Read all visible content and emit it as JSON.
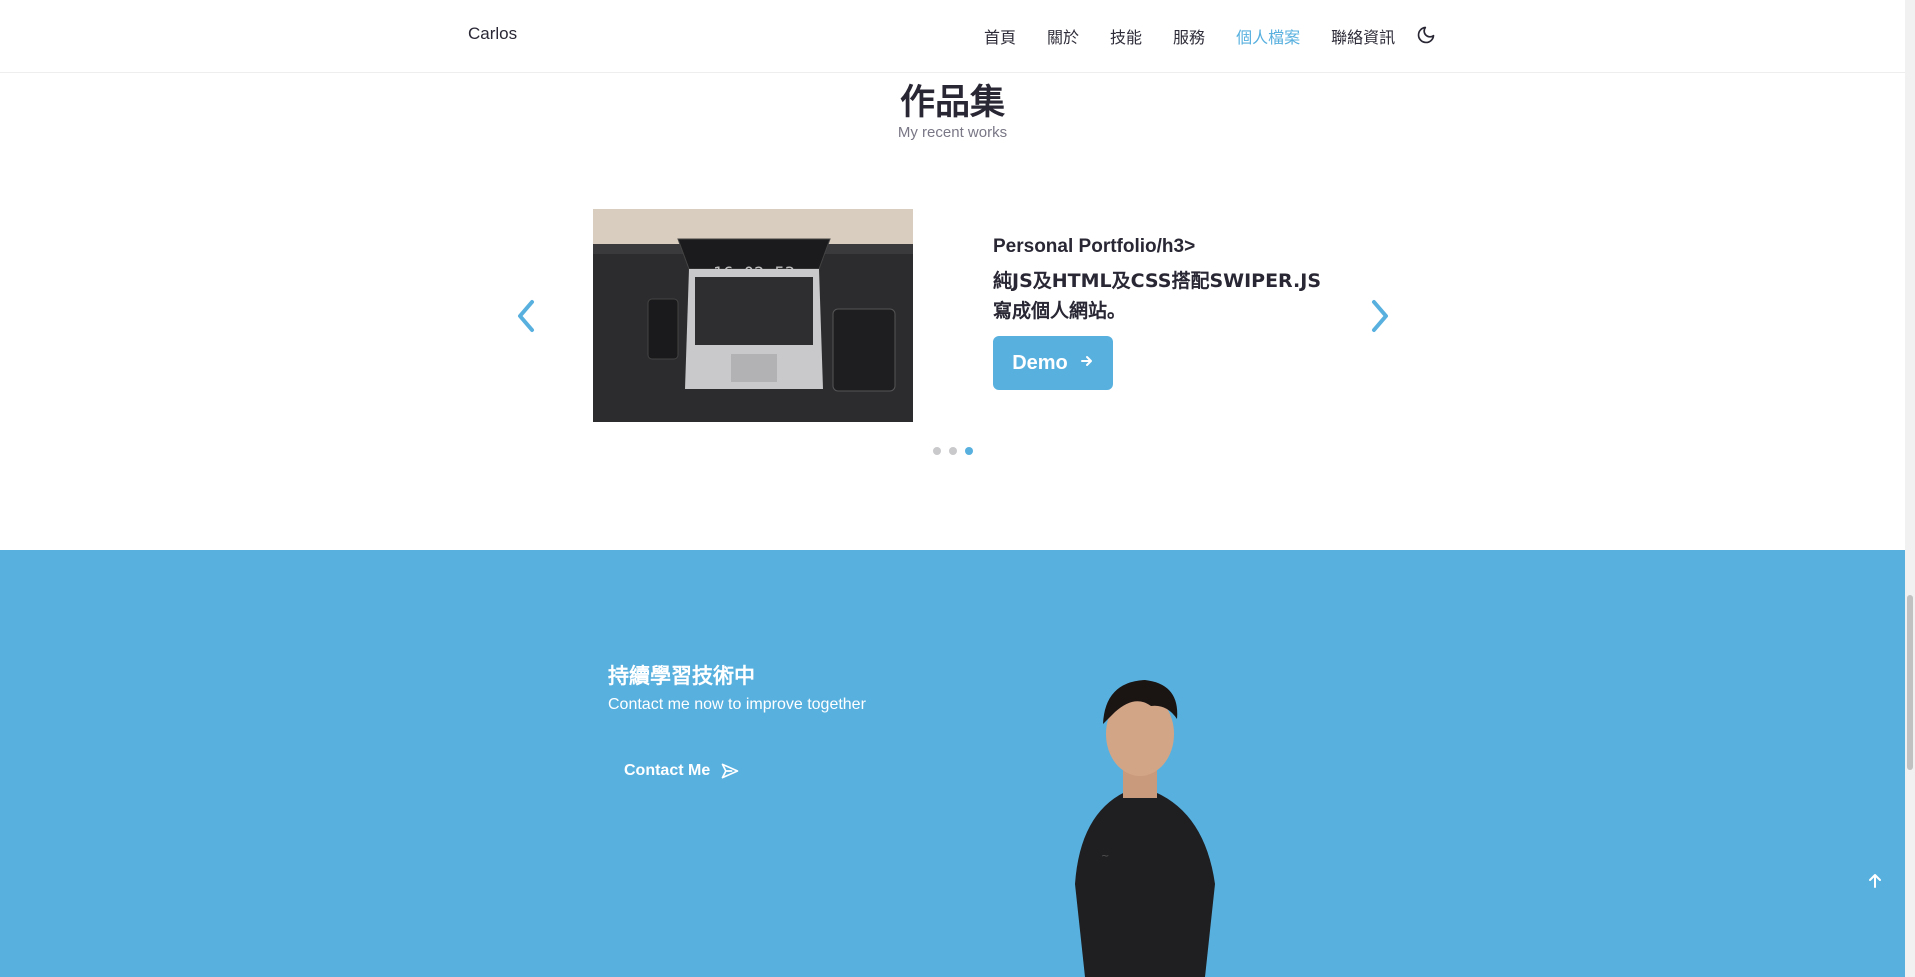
{
  "header": {
    "logo": "Carlos",
    "nav": [
      {
        "label": "首頁"
      },
      {
        "label": "關於"
      },
      {
        "label": "技能"
      },
      {
        "label": "服務"
      },
      {
        "label": "個人檔案",
        "active": true
      },
      {
        "label": "聯絡資訊"
      }
    ],
    "theme_icon": "moon-icon"
  },
  "portfolio": {
    "title": "作品集",
    "subtitle": "My recent works",
    "item": {
      "title": "Personal Portfolio/h3>",
      "desc_line1": "純JS及HTML及CSS搭配SWIPER.JS",
      "desc_line2": "寫成個人網站。",
      "button_label": "Demo",
      "image_clock": "16 02 53"
    },
    "slides_total": 3,
    "active_slide": 3
  },
  "cta": {
    "title": "持續學習技術中",
    "subtitle": "Contact me now to improve together",
    "button_label": "Contact Me"
  },
  "colors": {
    "accent": "#58b0df",
    "text": "#2a2734",
    "muted": "#7a7786"
  }
}
